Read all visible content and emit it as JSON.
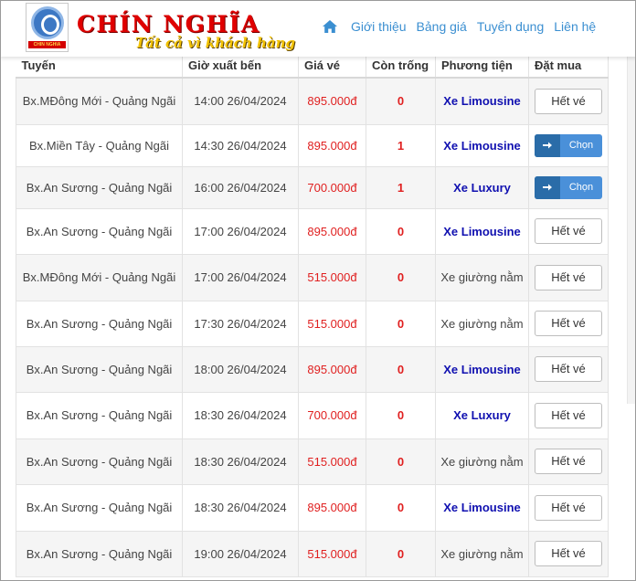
{
  "brand": {
    "name": "CHÍN NGHĨA",
    "slogan": "Tất cả vì khách hàng",
    "logo_caption": "CHIN NGHIA",
    "accent": "#e00000",
    "slogan_color": "#f2c200"
  },
  "nav": {
    "home_icon": "home-icon",
    "items": [
      "Giới thiệu",
      "Bảng giá",
      "Tuyển dụng",
      "Liên hệ"
    ],
    "color": "#3b8fd1"
  },
  "table": {
    "headers": [
      "Tuyến",
      "Giờ xuất bến",
      "Giá vé",
      "Còn trống",
      "Phương tiện",
      "Đặt mua"
    ],
    "rows": [
      {
        "route": "Bx.MĐông Mới - Quảng Ngãi",
        "time": "14:00 26/04/2024",
        "price": "895.000đ",
        "seats": "0",
        "vehicle": "Xe Limousine",
        "vehicle_bold": true,
        "action": "Hết vé",
        "available": false
      },
      {
        "route": "Bx.Miền Tây - Quảng Ngãi",
        "time": "14:30 26/04/2024",
        "price": "895.000đ",
        "seats": "1",
        "vehicle": "Xe Limousine",
        "vehicle_bold": true,
        "action": "Chọn",
        "available": true
      },
      {
        "route": "Bx.An Sương - Quảng Ngãi",
        "time": "16:00 26/04/2024",
        "price": "700.000đ",
        "seats": "1",
        "vehicle": "Xe Luxury",
        "vehicle_bold": true,
        "action": "Chọn",
        "available": true
      },
      {
        "route": "Bx.An Sương - Quảng Ngãi",
        "time": "17:00 26/04/2024",
        "price": "895.000đ",
        "seats": "0",
        "vehicle": "Xe Limousine",
        "vehicle_bold": true,
        "action": "Hết vé",
        "available": false
      },
      {
        "route": "Bx.MĐông Mới - Quảng Ngãi",
        "time": "17:00 26/04/2024",
        "price": "515.000đ",
        "seats": "0",
        "vehicle": "Xe giường nằm",
        "vehicle_bold": false,
        "action": "Hết vé",
        "available": false
      },
      {
        "route": "Bx.An Sương - Quảng Ngãi",
        "time": "17:30 26/04/2024",
        "price": "515.000đ",
        "seats": "0",
        "vehicle": "Xe giường nằm",
        "vehicle_bold": false,
        "action": "Hết vé",
        "available": false
      },
      {
        "route": "Bx.An Sương - Quảng Ngãi",
        "time": "18:00 26/04/2024",
        "price": "895.000đ",
        "seats": "0",
        "vehicle": "Xe Limousine",
        "vehicle_bold": true,
        "action": "Hết vé",
        "available": false
      },
      {
        "route": "Bx.An Sương - Quảng Ngãi",
        "time": "18:30 26/04/2024",
        "price": "700.000đ",
        "seats": "0",
        "vehicle": "Xe Luxury",
        "vehicle_bold": true,
        "action": "Hết vé",
        "available": false
      },
      {
        "route": "Bx.An Sương - Quảng Ngãi",
        "time": "18:30 26/04/2024",
        "price": "515.000đ",
        "seats": "0",
        "vehicle": "Xe giường nằm",
        "vehicle_bold": false,
        "action": "Hết vé",
        "available": false
      },
      {
        "route": "Bx.An Sương - Quảng Ngãi",
        "time": "18:30 26/04/2024",
        "price": "895.000đ",
        "seats": "0",
        "vehicle": "Xe Limousine",
        "vehicle_bold": true,
        "action": "Hết vé",
        "available": false
      },
      {
        "route": "Bx.An Sương - Quảng Ngãi",
        "time": "19:00 26/04/2024",
        "price": "515.000đ",
        "seats": "0",
        "vehicle": "Xe giường nằm",
        "vehicle_bold": false,
        "action": "Hết vé",
        "available": false
      }
    ],
    "choose_icon": "arrow-right-icon"
  }
}
